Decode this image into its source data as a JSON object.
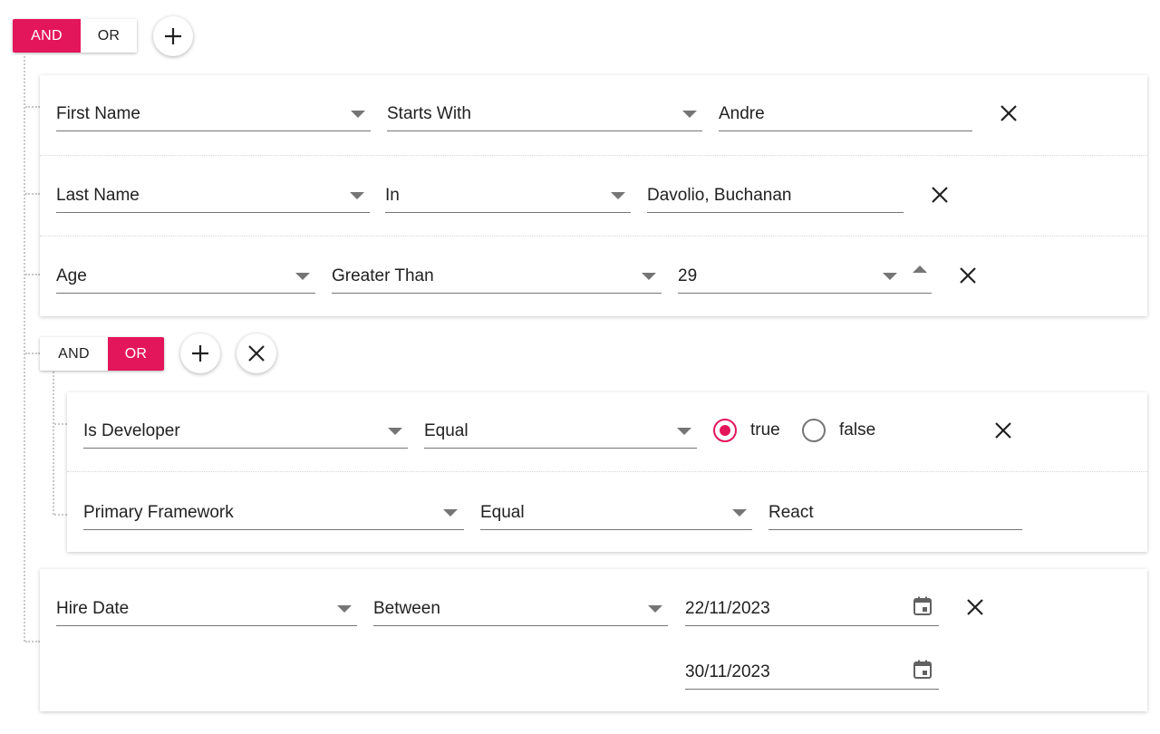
{
  "root_group": {
    "condition_options": [
      "AND",
      "OR"
    ],
    "selected_condition": "AND"
  },
  "rules": [
    {
      "field": "First Name",
      "operator": "Starts With",
      "value": "Andre"
    },
    {
      "field": "Last Name",
      "operator": "In",
      "value": "Davolio, Buchanan"
    },
    {
      "field": "Age",
      "operator": "Greater Than",
      "value": "29"
    }
  ],
  "nested_group": {
    "condition_options": [
      "AND",
      "OR"
    ],
    "selected_condition": "OR",
    "rules": [
      {
        "field": "Is Developer",
        "operator": "Equal",
        "radio_options": [
          "true",
          "false"
        ],
        "selected": "true"
      },
      {
        "field": "Primary Framework",
        "operator": "Equal",
        "value": "React"
      }
    ]
  },
  "date_rule": {
    "field": "Hire Date",
    "operator": "Between",
    "start_date": "22/11/2023",
    "end_date": "30/11/2023"
  },
  "icons": {
    "add": "plus-icon",
    "delete": "close-icon",
    "dropdown": "caret-down-icon",
    "spin_up": "caret-up-icon",
    "calendar": "calendar-icon"
  },
  "colors": {
    "accent": "#e3165b",
    "connector": "#c8c8c8",
    "underline": "#757575"
  }
}
